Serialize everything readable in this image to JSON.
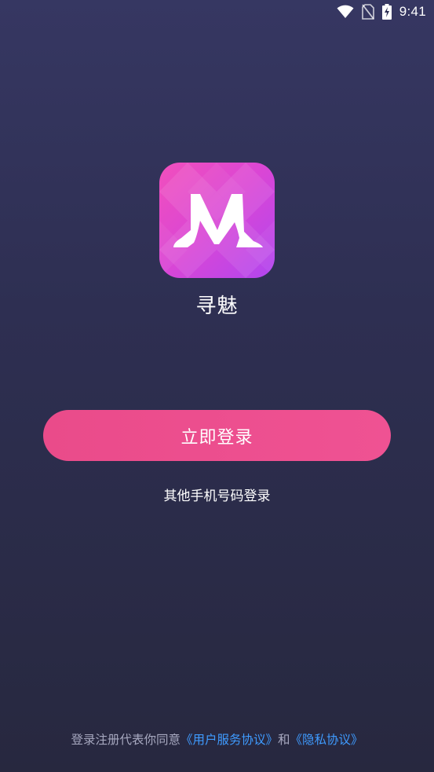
{
  "status_bar": {
    "time": "9:41",
    "icons": [
      "wifi-icon",
      "no-sim-icon",
      "battery-charging-icon"
    ]
  },
  "app": {
    "logo_icon": "high-heels-m-logo",
    "logo_letter": "M",
    "name": "寻魅"
  },
  "actions": {
    "login_button_label": "立即登录",
    "other_phone_login_label": "其他手机号码登录"
  },
  "agreement": {
    "prefix": "登录注册代表你同意",
    "user_agreement_link": "《用户服务协议》",
    "conjunction": "和",
    "privacy_link": "《隐私协议》"
  },
  "colors": {
    "background_top": "#363762",
    "background_bottom": "#27283f",
    "button": "#ea4b8a",
    "link": "#3f9bff",
    "logo_start": "#f24fbc",
    "logo_end": "#b146ef"
  }
}
